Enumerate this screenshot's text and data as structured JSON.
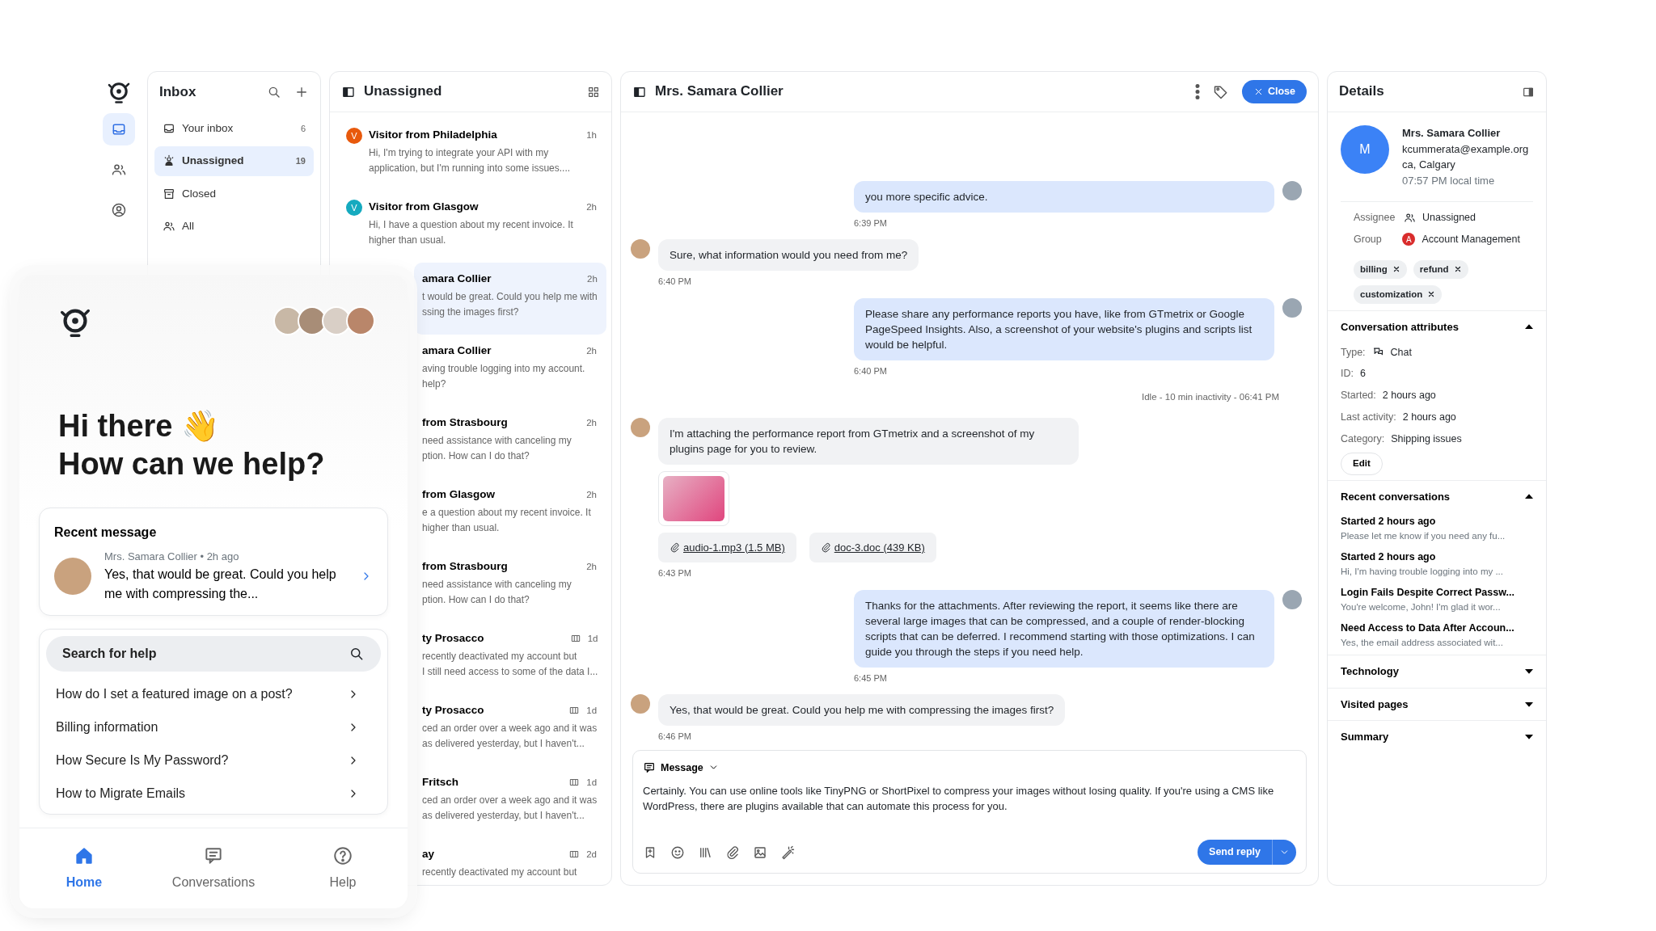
{
  "rail": {
    "items": [
      {
        "kind": "inbox",
        "selected": true
      },
      {
        "kind": "contacts",
        "selected": false
      },
      {
        "kind": "profile",
        "selected": false
      }
    ]
  },
  "inbox": {
    "title": "Inbox",
    "items": [
      {
        "kind": "tray",
        "label": "Your inbox",
        "count": "6",
        "selected": false
      },
      {
        "kind": "unassigned",
        "label": "Unassigned",
        "count": "19",
        "selected": true
      },
      {
        "kind": "archive",
        "label": "Closed",
        "selected": false
      },
      {
        "kind": "all",
        "label": "All",
        "selected": false
      }
    ]
  },
  "conversation_list": {
    "title": "Unassigned",
    "items": [
      {
        "kind": "full",
        "avatar": "V",
        "color": "#e8590c",
        "title": "Visitor from Philadelphia",
        "time": "1h",
        "preview": "Hi, I'm trying to integrate your API with my application, but I'm running into some issues....",
        "selected": false,
        "ticket": false
      },
      {
        "kind": "full",
        "avatar": "V",
        "color": "#15aabf",
        "title": "Visitor from Glasgow",
        "time": "2h",
        "preview": "Hi, I have a question about my recent invoice. It\nhigher than usual.",
        "selected": false,
        "ticket": false
      },
      {
        "kind": "clipped",
        "title": "amara Collier",
        "time": "2h",
        "preview": "t would be great. Could you help me with\nssing the images first?",
        "selected": true,
        "ticket": false
      },
      {
        "kind": "clipped",
        "title": "amara Collier",
        "time": "2h",
        "preview": "aving trouble logging into my account.\nhelp?",
        "selected": false,
        "ticket": false
      },
      {
        "kind": "clipped",
        "title": "from Strasbourg",
        "time": "2h",
        "preview": "need assistance with canceling my\nption. How can I do that?",
        "selected": false,
        "ticket": false
      },
      {
        "kind": "clipped",
        "title": "from Glasgow",
        "time": "2h",
        "preview": "e a question about my recent invoice. It\nhigher than usual.",
        "selected": false,
        "ticket": false
      },
      {
        "kind": "clipped",
        "title": "from Strasbourg",
        "time": "2h",
        "preview": "need assistance with canceling my\nption. How can I do that?",
        "selected": false,
        "ticket": false
      },
      {
        "kind": "clipped",
        "title": "ty Prosacco",
        "time": "1d",
        "preview": "recently deactivated my account but\nI still need access to some of the data I...",
        "selected": false,
        "ticket": true
      },
      {
        "kind": "clipped",
        "title": "ty Prosacco",
        "time": "1d",
        "preview": "ced an order over a week ago and it was\nas delivered yesterday, but I haven't...",
        "selected": false,
        "ticket": true
      },
      {
        "kind": "clipped",
        "title": "Fritsch",
        "time": "1d",
        "preview": "ced an order over a week ago and it was\nas delivered yesterday, but I haven't...",
        "selected": false,
        "ticket": true
      },
      {
        "kind": "clipped",
        "title": "ay",
        "time": "2d",
        "preview": "recently deactivated my account but",
        "selected": false,
        "ticket": true
      }
    ]
  },
  "chat": {
    "title": "Mrs. Samara Collier",
    "close_label": "Close",
    "messages": [
      {
        "kind": "agent",
        "text": "you more specific advice.",
        "time": "6:39 PM"
      },
      {
        "kind": "customer",
        "text": "Sure, what information would you need from me?",
        "time": "6:40 PM"
      },
      {
        "kind": "agent",
        "text": "Please share any performance reports you have, like from GTmetrix or Google PageSpeed Insights. Also, a screenshot of your website's plugins and scripts list would be helpful.",
        "time": "6:40 PM"
      },
      {
        "kind": "system",
        "text": "Idle - 10 min inactivity - 06:41 PM"
      },
      {
        "kind": "customer",
        "text": "I'm attaching the performance report from GTmetrix and a screenshot of my plugins page for you to review.",
        "attachments": [
          {
            "kind": "image"
          },
          {
            "kind": "file",
            "name": "audio-1.mp3 (1.5 MB)"
          },
          {
            "kind": "file",
            "name": "doc-3.doc (439 KB)"
          }
        ],
        "time": "6:43 PM"
      },
      {
        "kind": "agent",
        "text": "Thanks for the attachments. After reviewing the report, it seems like there are several large images that can be compressed, and a couple of render-blocking scripts that can be deferred. I recommend starting with those optimizations. I can guide you through the steps if you need help.",
        "time": "6:45 PM"
      },
      {
        "kind": "customer",
        "text": "Yes, that would be great. Could you help me with compressing the images first?",
        "time": "6:46 PM"
      }
    ],
    "composer": {
      "mode": "Message",
      "text": "Certainly. You can use online tools like TinyPNG or ShortPixel to compress your images without losing quality. If you're using a CMS like WordPress, there are plugins available that can automate this process for you.",
      "send_label": "Send reply"
    }
  },
  "details": {
    "title": "Details",
    "contact": {
      "initial": "M",
      "name": "Mrs. Samara Collier",
      "email": "kcummerata@example.org",
      "location": "ca, Calgary",
      "local_time": "07:57 PM local time"
    },
    "fields": [
      {
        "kind": "person",
        "label": "Assignee",
        "value": "Unassigned"
      },
      {
        "kind": "group",
        "label": "Group",
        "badge": "A",
        "value": "Account Management"
      }
    ],
    "tags": [
      "billing",
      "refund",
      "customization"
    ],
    "sections": [
      {
        "kind": "attributes",
        "title": "Conversation attributes",
        "expanded": true,
        "rows": [
          {
            "kind": "chat",
            "label": "Type:",
            "value": "Chat"
          },
          {
            "kind": "plain",
            "label": "ID:",
            "value": "6"
          },
          {
            "kind": "plain",
            "label": "Started:",
            "value": "2 hours ago"
          },
          {
            "kind": "plain",
            "label": "Last activity:",
            "value": "2 hours ago"
          },
          {
            "kind": "plain",
            "label": "Category:",
            "value": "Shipping issues"
          }
        ],
        "action": "Edit"
      },
      {
        "kind": "recent",
        "title": "Recent conversations",
        "expanded": true,
        "items": [
          {
            "title": "Started 2 hours ago",
            "preview": "Please let me know if you need any fu..."
          },
          {
            "title": "Started 2 hours ago",
            "preview": "Hi, I'm having trouble logging into my ..."
          },
          {
            "title": "Login Fails Despite Correct Passw...",
            "preview": "You're welcome, John! I'm glad it wor..."
          },
          {
            "title": "Need Access to Data After Accoun...",
            "preview": "Yes, the email address associated wit..."
          }
        ]
      },
      {
        "title": "Technology",
        "expanded": false
      },
      {
        "title": "Visited pages",
        "expanded": false
      },
      {
        "title": "Summary",
        "expanded": false
      }
    ]
  },
  "widget": {
    "greeting": "Hi there 👋",
    "headline": "How can we help?",
    "recent": {
      "title": "Recent message",
      "meta": "Mrs. Samara Collier • 2h ago",
      "text": "Yes, that would be great. Could you help me with compressing the..."
    },
    "search": {
      "placeholder": "Search for help"
    },
    "articles": [
      "How do I set a featured image on a post?",
      "Billing information",
      "How Secure Is My Password?",
      "How to Migrate Emails"
    ],
    "tabs": [
      {
        "kind": "home",
        "label": "Home",
        "selected": true
      },
      {
        "kind": "chat",
        "label": "Conversations",
        "selected": false
      },
      {
        "kind": "help",
        "label": "Help",
        "selected": false
      }
    ]
  }
}
